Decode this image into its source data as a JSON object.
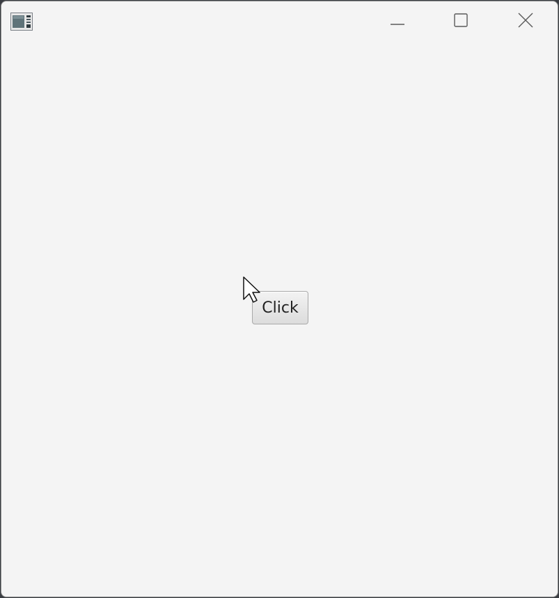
{
  "window": {
    "background": "#f4f4f4",
    "app_icon": "app-window-icon",
    "controls": {
      "minimize_icon": "minimize-icon",
      "maximize_icon": "maximize-icon",
      "close_icon": "close-icon"
    }
  },
  "content": {
    "button_label": "Click"
  },
  "cursor": {
    "icon": "mouse-pointer-icon"
  }
}
